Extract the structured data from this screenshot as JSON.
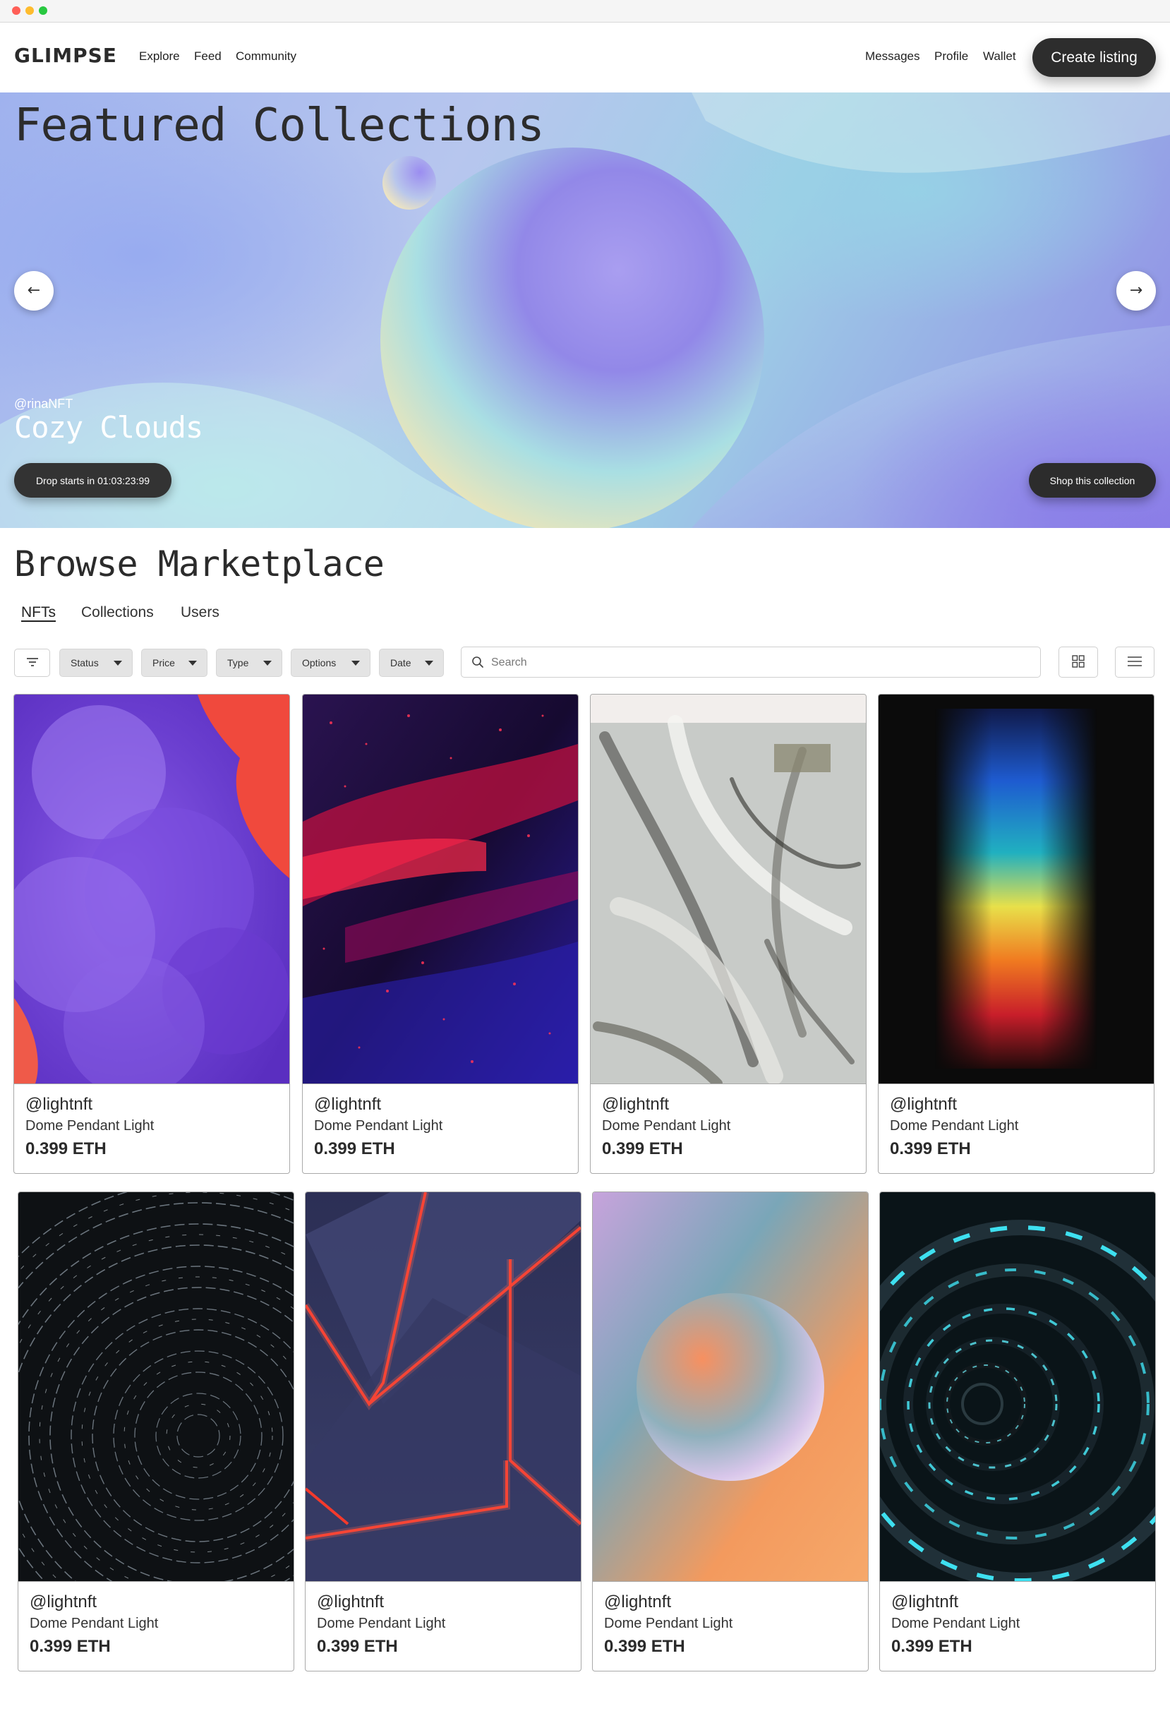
{
  "brand": {
    "logo": "GLIMPSE"
  },
  "nav": {
    "left": [
      "Explore",
      "Feed",
      "Community"
    ],
    "right": [
      "Messages",
      "Profile",
      "Wallet"
    ],
    "cta": "Create listing"
  },
  "hero": {
    "title": "Featured Collections",
    "creator": "@rinaNFT",
    "collection": "Cozy Clouds",
    "drop_label": "Drop starts in 01:03:23:99",
    "shop_label": "Shop this collection",
    "prev_icon": "arrow-left-icon",
    "next_icon": "arrow-right-icon"
  },
  "browse": {
    "title": "Browse Marketplace",
    "tabs": [
      "NFTs",
      "Collections",
      "Users"
    ],
    "active_tab": "NFTs",
    "filters": [
      "Status",
      "Price",
      "Type",
      "Options",
      "Date"
    ],
    "search_placeholder": "Search",
    "view_icons": [
      "grid-view-icon",
      "list-view-icon"
    ]
  },
  "cards": [
    {
      "user": "@lightnft",
      "title": "Dome Pendant Light",
      "price": "0.399 ETH",
      "art": "purple-smoke"
    },
    {
      "user": "@lightnft",
      "title": "Dome Pendant Light",
      "price": "0.399 ETH",
      "art": "red-particles"
    },
    {
      "user": "@lightnft",
      "title": "Dome Pendant Light",
      "price": "0.399 ETH",
      "art": "gray-brushstrokes"
    },
    {
      "user": "@lightnft",
      "title": "Dome Pendant Light",
      "price": "0.399 ETH",
      "art": "rainbow-light"
    },
    {
      "user": "@lightnft",
      "title": "Dome Pendant Light",
      "price": "0.399 ETH",
      "art": "star-trails"
    },
    {
      "user": "@lightnft",
      "title": "Dome Pendant Light",
      "price": "0.399 ETH",
      "art": "red-neon-triangles"
    },
    {
      "user": "@lightnft",
      "title": "Dome Pendant Light",
      "price": "0.399 ETH",
      "art": "gradient-sphere"
    },
    {
      "user": "@lightnft",
      "title": "Dome Pendant Light",
      "price": "0.399 ETH",
      "art": "cyan-tunnel"
    }
  ]
}
